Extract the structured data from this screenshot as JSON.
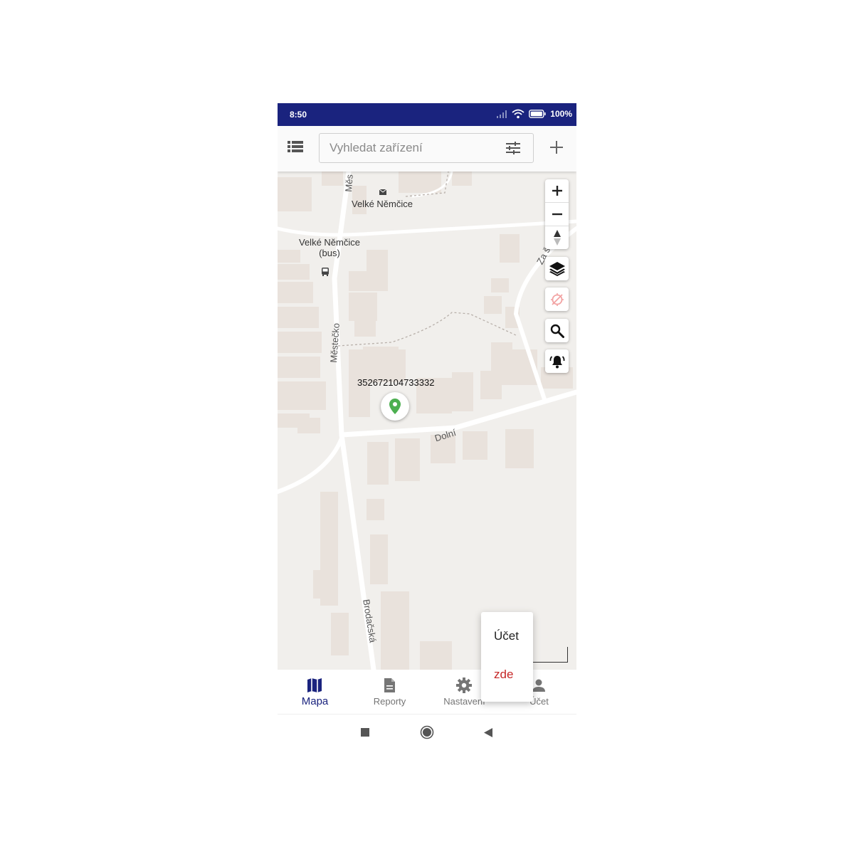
{
  "status_bar": {
    "time": "8:50",
    "battery": "100%"
  },
  "toolbar": {
    "search_placeholder": "Vyhledat zařízení"
  },
  "map": {
    "labels": {
      "place": "Velké Němčice",
      "bus_stop": "Velké Němčice\n(bus)",
      "street_mestecko": "Městečko",
      "street_mestecko_top": "Měs",
      "street_dolni": "Dolní",
      "street_brodacska": "Brodačská",
      "street_za": "Za š"
    },
    "device": {
      "id": "352672104733332",
      "marker_color": "#4caf50"
    },
    "controls": [
      "zoom-in",
      "zoom-out",
      "compass",
      "layers",
      "location-off",
      "search",
      "alarm"
    ]
  },
  "bottom_nav": {
    "items": [
      {
        "label": "Mapa",
        "active": true
      },
      {
        "label": "Reporty",
        "active": false
      },
      {
        "label": "Nastavení",
        "active": false
      },
      {
        "label": "Účet",
        "active": false
      }
    ]
  },
  "popup_menu": {
    "item_account": "Účet",
    "item_here": "zde"
  },
  "colors": {
    "primary": "#1a237e",
    "accent_red": "#c62828",
    "map_bg": "#f1efec",
    "marker_green": "#4caf50"
  }
}
